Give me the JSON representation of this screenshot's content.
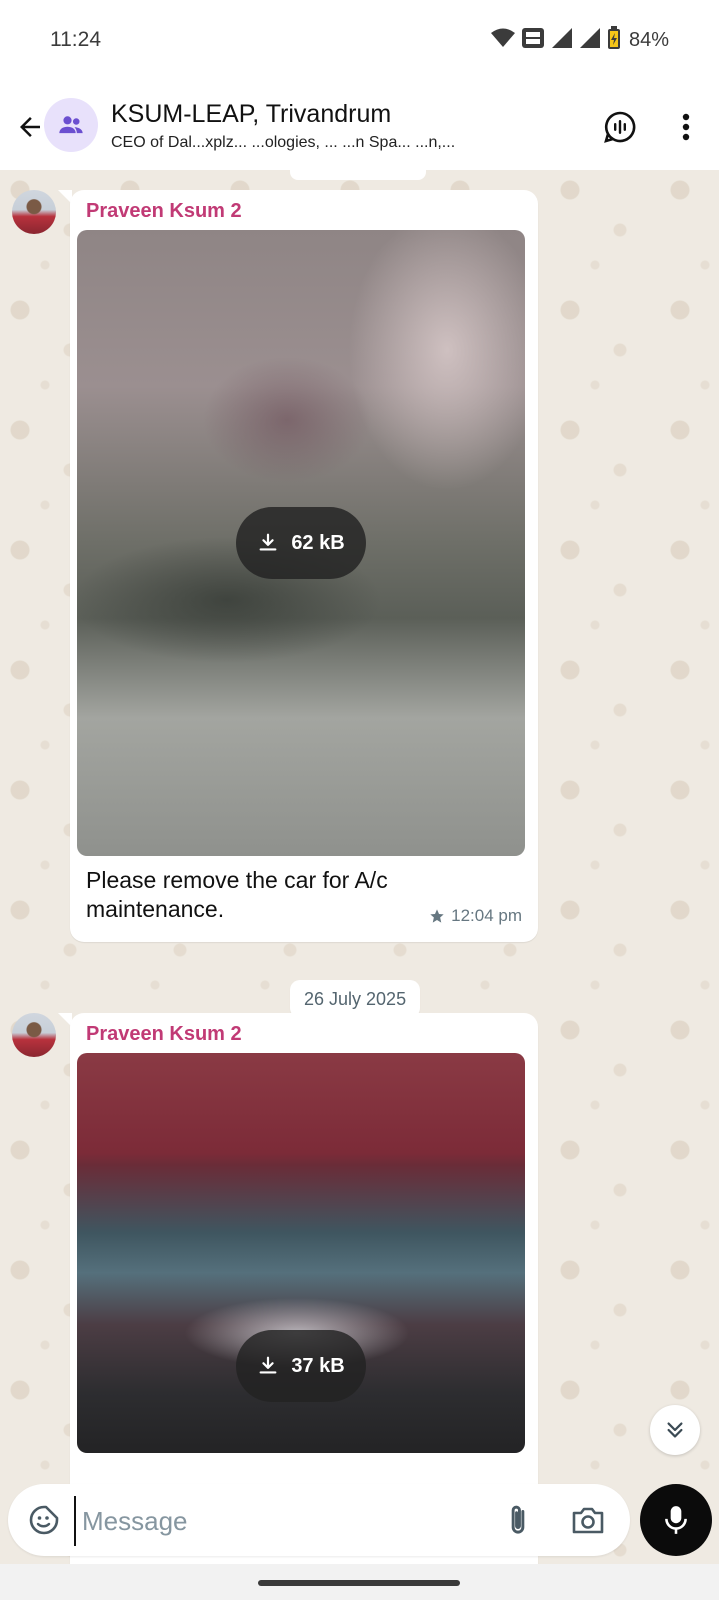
{
  "status_bar": {
    "time": "11:24",
    "battery": "84%"
  },
  "header": {
    "title": "KSUM-LEAP, Trivandrum",
    "subtitle": "CEO of Dal...xplz... ...ologies, ... ...n Spa... ...n,..."
  },
  "messages": [
    {
      "sender": "Praveen Ksum 2",
      "media_size": "62 kB",
      "caption": "Please remove the car for A/c maintenance.",
      "time": "12:04 pm",
      "starred": true
    },
    {
      "sender": "Praveen Ksum 2",
      "media_size": "37 kB"
    }
  ],
  "date_divider": "26 July 2025",
  "composer": {
    "placeholder": "Message"
  },
  "colors": {
    "sender": "#c13a75",
    "chat_bg": "#efeae2",
    "mic_button": "#0b0b0b"
  },
  "icons": [
    "back-arrow-icon",
    "group-icon",
    "voice-chat-icon",
    "more-vert-icon",
    "download-icon",
    "star-icon",
    "double-chevron-down-icon",
    "sticker-icon",
    "attach-icon",
    "camera-icon",
    "mic-icon",
    "wifi-icon",
    "signal-icon",
    "battery-icon"
  ]
}
